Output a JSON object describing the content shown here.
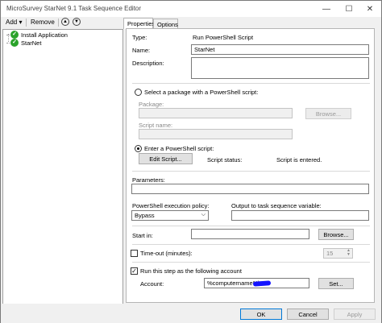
{
  "window": {
    "title": "MicroSurvey StarNet 9.1 Task Sequence Editor",
    "minimize_icon": "minimize-icon",
    "maximize_icon": "maximize-icon",
    "close_icon": "close-icon"
  },
  "toolbar": {
    "add_label": "Add",
    "add_arrow": "▾",
    "remove_label": "Remove"
  },
  "tree": {
    "items": [
      {
        "label": "Install Application",
        "icon": "check-circle-icon"
      },
      {
        "label": "StarNet",
        "icon": "check-circle-icon"
      }
    ]
  },
  "tabs": [
    {
      "label": "Properties",
      "active": true
    },
    {
      "label": "Options",
      "active": false
    }
  ],
  "properties": {
    "type_label": "Type:",
    "type_value": "Run PowerShell Script",
    "name_label": "Name:",
    "name_value": "StarNet",
    "description_label": "Description:",
    "description_value": "",
    "package_radio_label": "Select a package with a PowerShell script:",
    "package_label": "Package:",
    "package_value": "",
    "browse_label": "Browse...",
    "script_name_label": "Script name:",
    "script_name_value": "",
    "enter_script_label": "Enter a PowerShell script:",
    "edit_script_label": "Edit Script...",
    "script_status_label": "Script status:",
    "script_status_value": "Script is entered.",
    "parameters_label": "Parameters:",
    "parameters_value": "",
    "policy_label": "PowerShell execution policy:",
    "policy_value": "Bypass",
    "output_label": "Output to task sequence variable:",
    "output_value": "",
    "start_in_label": "Start in:",
    "start_in_value": "",
    "start_in_browse_label": "Browse...",
    "timeout_label": "Time-out (minutes):",
    "timeout_value": "15",
    "run_as_label": "Run this step as the following account",
    "account_label": "Account:",
    "account_value": "%computername%\\",
    "set_label": "Set..."
  },
  "footer": {
    "ok_label": "OK",
    "cancel_label": "Cancel",
    "apply_label": "Apply"
  },
  "colors": {
    "accent": "#0078d7",
    "check_green": "#2aa32a",
    "redaction_blue": "#1414ff"
  }
}
